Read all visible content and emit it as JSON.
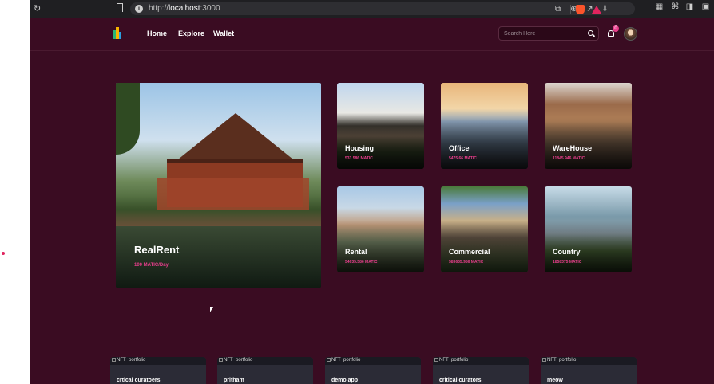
{
  "browser": {
    "url_prefix": "http://",
    "url_host": "localhost",
    "url_port": ":3000"
  },
  "nav": {
    "links": [
      "Home",
      "Explore",
      "Wallet"
    ],
    "search_placeholder": "Search Here",
    "notification_count": "0"
  },
  "hero": {
    "title": "RealRent",
    "subtitle": "100 MATIC/Day"
  },
  "categories": [
    {
      "label": "Housing",
      "price": "533.586 MATIC"
    },
    {
      "label": "Office",
      "price": "5475.66 MATIC"
    },
    {
      "label": "WareHouse",
      "price": "11845.946 MATIC"
    },
    {
      "label": "Rental",
      "price": "54635.586 MATIC"
    },
    {
      "label": "Commercial",
      "price": "583635.986 MATIC"
    },
    {
      "label": "Country",
      "price": "1858375 MATIC"
    }
  ],
  "portfolios": [
    {
      "alt": "NFT_portfolio",
      "name": "crtical curatoers"
    },
    {
      "alt": "NFT_portfolio",
      "name": "pritham"
    },
    {
      "alt": "NFT_portfolio",
      "name": "demo app"
    },
    {
      "alt": "NFT_portfolio",
      "name": "critical curators"
    },
    {
      "alt": "NFT_portfolio",
      "name": "meow"
    }
  ],
  "colors": {
    "background": "#3a0c22",
    "accent": "#e83e8c",
    "card": "#2b2b36"
  }
}
